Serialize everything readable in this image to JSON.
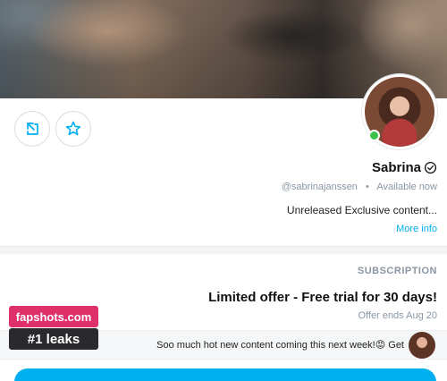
{
  "profile": {
    "display_name": "Sabrina",
    "handle": "@sabrinajanssen",
    "status": "Available now",
    "separator": "•",
    "bio": "Unreleased Exclusive content...",
    "more_info": "More info",
    "status_color": "#3ac34a"
  },
  "actions": {
    "share_icon": "share-icon",
    "favorite_icon": "star-icon"
  },
  "subscription": {
    "section_title": "SUBSCRIPTION",
    "offer_title": "Limited offer - Free trial for 30 days!",
    "offer_ends": "Offer ends Aug 20",
    "message": "Soo much hot new content coming this next week!😡 Get",
    "accent_color": "#00aff0"
  },
  "watermark": {
    "site": "fapshots.com",
    "tagline": "#1 leaks"
  }
}
